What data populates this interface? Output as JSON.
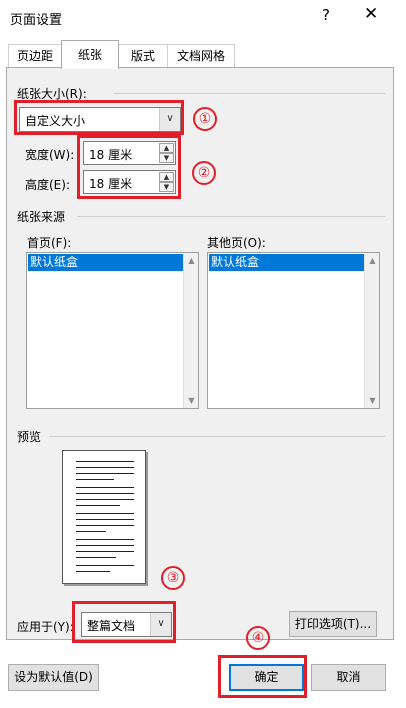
{
  "window": {
    "title": "页面设置",
    "help": "?",
    "close": "✕"
  },
  "tabs": [
    {
      "label": "页边距"
    },
    {
      "label": "纸张"
    },
    {
      "label": "版式"
    },
    {
      "label": "文档网格"
    }
  ],
  "paper_size": {
    "group_label": "纸张大小(R):",
    "selected": "自定义大小",
    "width_label": "宽度(W):",
    "width_value": "18 厘米",
    "height_label": "高度(E):",
    "height_value": "18 厘米"
  },
  "paper_source": {
    "group_label": "纸张来源",
    "first_page_label": "首页(F):",
    "first_page_selected": "默认纸盒",
    "other_pages_label": "其他页(O):",
    "other_pages_selected": "默认纸盒"
  },
  "preview": {
    "label": "预览"
  },
  "apply": {
    "label": "应用于(Y):",
    "selected": "整篇文档"
  },
  "buttons": {
    "print_options": "打印选项(T)...",
    "set_default": "设为默认值(D)",
    "ok": "确定",
    "cancel": "取消"
  },
  "annotations": [
    "①",
    "②",
    "③",
    "④"
  ],
  "colors": {
    "annotation_red": "#e01f2a",
    "selection_blue": "#0078d7"
  }
}
